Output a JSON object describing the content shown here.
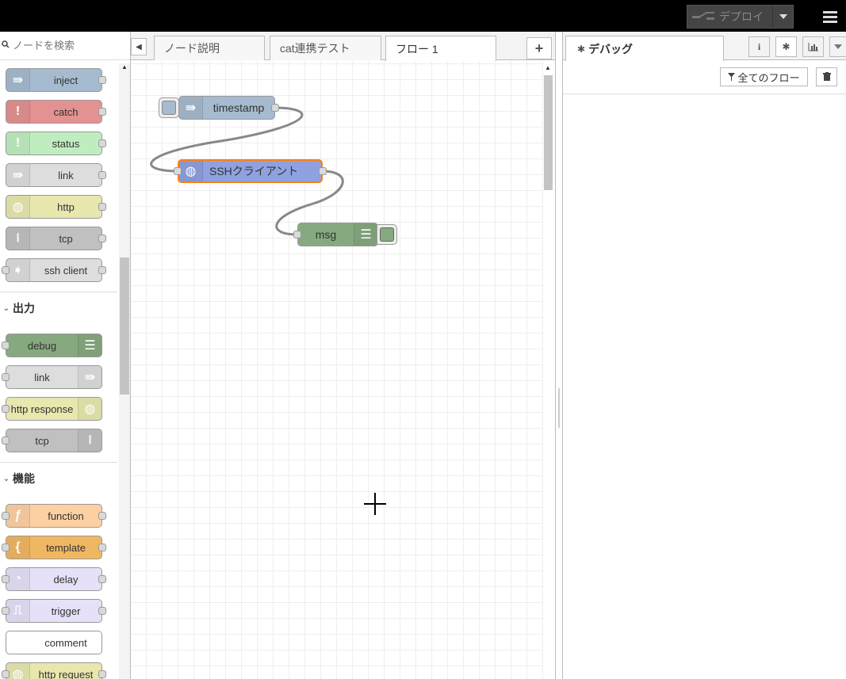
{
  "header": {
    "deploy_label": "デプロイ",
    "deploy_icon": "deploy-icon",
    "menu_icon": "hamburger-menu-icon"
  },
  "palette": {
    "search_placeholder": "ノードを検索",
    "input_nodes": [
      {
        "label": "inject",
        "color": "#a6bbcf",
        "icon": "arrow-in-icon"
      },
      {
        "label": "catch",
        "color": "#e49191",
        "icon": "exclamation-icon"
      },
      {
        "label": "status",
        "color": "#c0edc0",
        "icon": "exclamation-icon"
      },
      {
        "label": "link",
        "color": "#dddddd",
        "icon": "link-in-icon"
      },
      {
        "label": "http",
        "color": "#e7e7ae",
        "icon": "globe-icon"
      },
      {
        "label": "tcp",
        "color": "#c0c0c0",
        "icon": "bridge-icon"
      },
      {
        "label": "ssh client",
        "color": "#dddddd",
        "icon": "arrow-right-icon"
      }
    ],
    "categories": [
      {
        "name": "出力"
      },
      {
        "name": "機能"
      }
    ],
    "output_nodes": [
      {
        "label": "debug",
        "color": "#87a980",
        "icon": "list-icon"
      },
      {
        "label": "link",
        "color": "#dddddd",
        "icon": "link-out-icon"
      },
      {
        "label": "http response",
        "color": "#e7e7ae",
        "icon": "globe-icon"
      },
      {
        "label": "tcp",
        "color": "#c0c0c0",
        "icon": "bridge-icon"
      }
    ],
    "function_nodes": [
      {
        "label": "function",
        "color": "#fdd0a2",
        "icon": "function-icon"
      },
      {
        "label": "template",
        "color": "#f0b762",
        "icon": "brace-icon"
      },
      {
        "label": "delay",
        "color": "#e6e0f8",
        "icon": "timer-icon"
      },
      {
        "label": "trigger",
        "color": "#e6e0f8",
        "icon": "trigger-icon"
      },
      {
        "label": "comment",
        "color": "#ffffff",
        "icon": "none"
      },
      {
        "label": "http request",
        "color": "#e7e7ae",
        "icon": "globe-icon"
      }
    ]
  },
  "workspace": {
    "tabs": [
      {
        "label": "ノード説明"
      },
      {
        "label": "cat連携テスト"
      },
      {
        "label": "フロー 1"
      }
    ],
    "active_tab": "フロー 1",
    "nodes": {
      "timestamp": {
        "label": "timestamp",
        "color": "#a6bbcf"
      },
      "ssh": {
        "label": "SSHクライアント",
        "color": "#8fa1e0"
      },
      "msg": {
        "label": "msg",
        "color": "#87a980"
      }
    }
  },
  "sidebar": {
    "tab_label": "デバッグ",
    "filter_label": "全てのフロー",
    "info_icon": "info-icon",
    "debug_icon": "bug-icon",
    "chart_icon": "chart-icon"
  }
}
